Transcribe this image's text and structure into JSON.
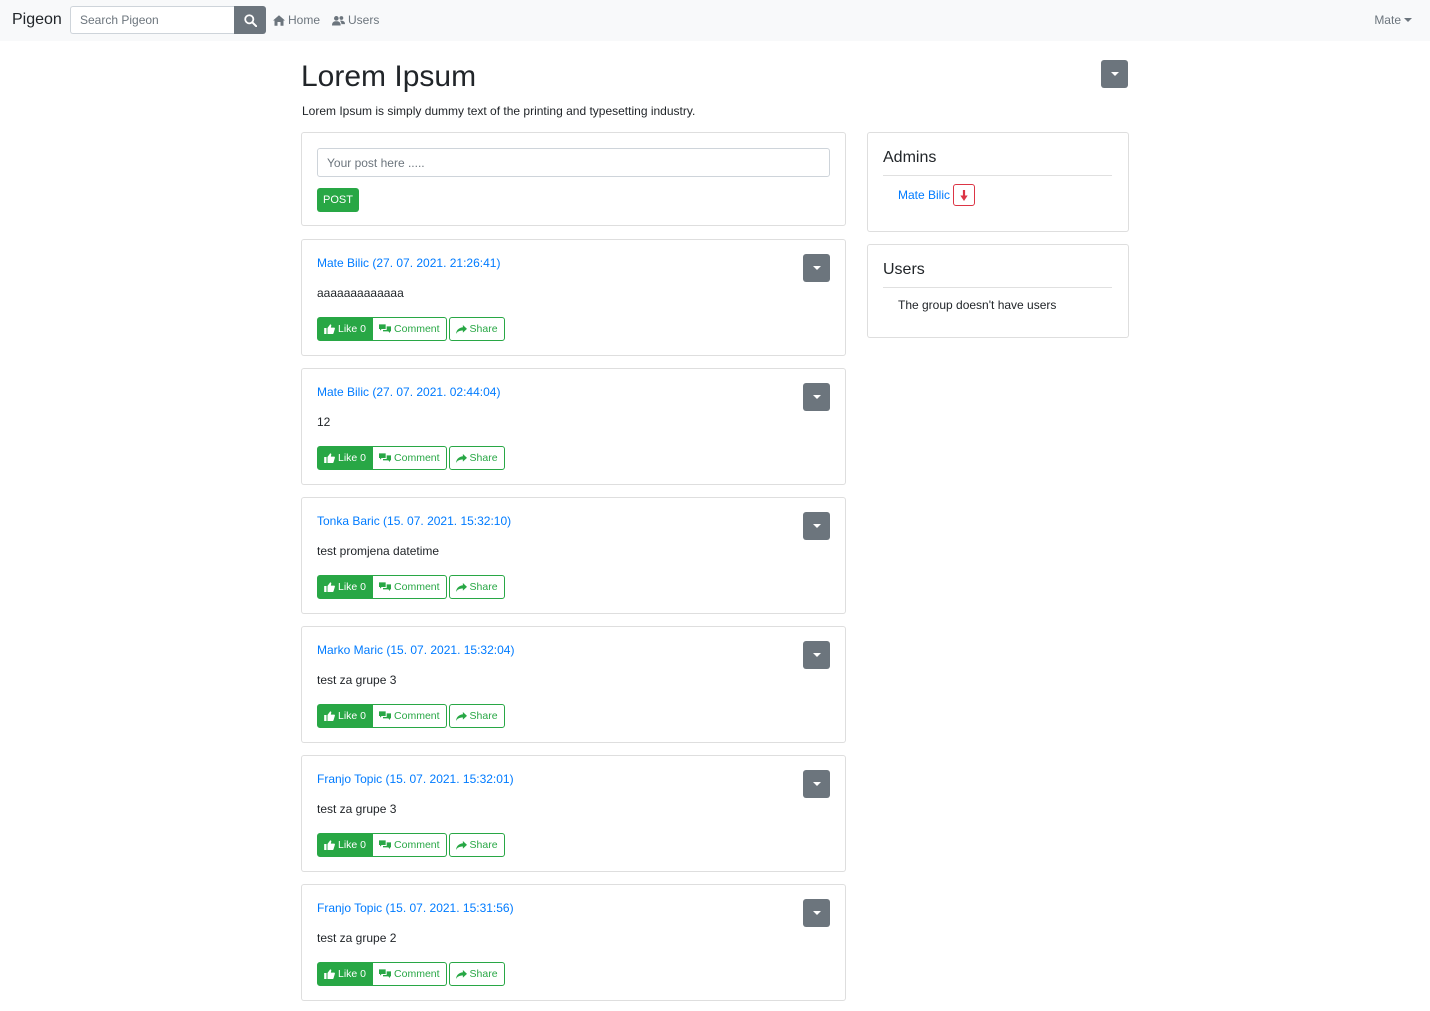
{
  "navbar": {
    "brand": "Pigeon",
    "search_placeholder": "Search Pigeon",
    "home_label": "Home",
    "users_label": "Users",
    "user_menu_label": "Mate"
  },
  "group": {
    "title": "Lorem Ipsum",
    "description": "Lorem Ipsum is simply dummy text of the printing and typesetting industry."
  },
  "new_post": {
    "placeholder": "Your post here .....",
    "button_label": "POST"
  },
  "posts": [
    {
      "author": "Mate Bilic",
      "timestamp": "(27. 07. 2021. 21:26:41)",
      "body": "aaaaaaaaaaaaa",
      "like_label": "Like 0",
      "comment_label": "Comment",
      "share_label": "Share"
    },
    {
      "author": "Mate Bilic",
      "timestamp": "(27. 07. 2021. 02:44:04)",
      "body": "12",
      "like_label": "Like 0",
      "comment_label": "Comment",
      "share_label": "Share"
    },
    {
      "author": "Tonka Baric",
      "timestamp": "(15. 07. 2021. 15:32:10)",
      "body": "test promjena datetime",
      "like_label": "Like 0",
      "comment_label": "Comment",
      "share_label": "Share"
    },
    {
      "author": "Marko Maric",
      "timestamp": "(15. 07. 2021. 15:32:04)",
      "body": "test za grupe 3",
      "like_label": "Like 0",
      "comment_label": "Comment",
      "share_label": "Share"
    },
    {
      "author": "Franjo Topic",
      "timestamp": "(15. 07. 2021. 15:32:01)",
      "body": "test za grupe 3",
      "like_label": "Like 0",
      "comment_label": "Comment",
      "share_label": "Share"
    },
    {
      "author": "Franjo Topic",
      "timestamp": "(15. 07. 2021. 15:31:56)",
      "body": "test za grupe 2",
      "like_label": "Like 0",
      "comment_label": "Comment",
      "share_label": "Share"
    }
  ],
  "sidebar": {
    "admins_title": "Admins",
    "admins": [
      "Mate Bilic"
    ],
    "users_title": "Users",
    "users_empty": "The group doesn't have users"
  },
  "icons": {
    "search": "search-icon",
    "home": "home-icon",
    "users": "users-icon",
    "like": "thumbs-up-icon",
    "comment": "comments-icon",
    "share": "share-icon",
    "demote": "arrow-down-icon",
    "dropdown": "caret-down-icon"
  },
  "colors": {
    "success": "#28a745",
    "link": "#007bff",
    "secondary": "#6c757d",
    "danger": "#dc3545",
    "navbar_bg": "#f8f9fa"
  }
}
